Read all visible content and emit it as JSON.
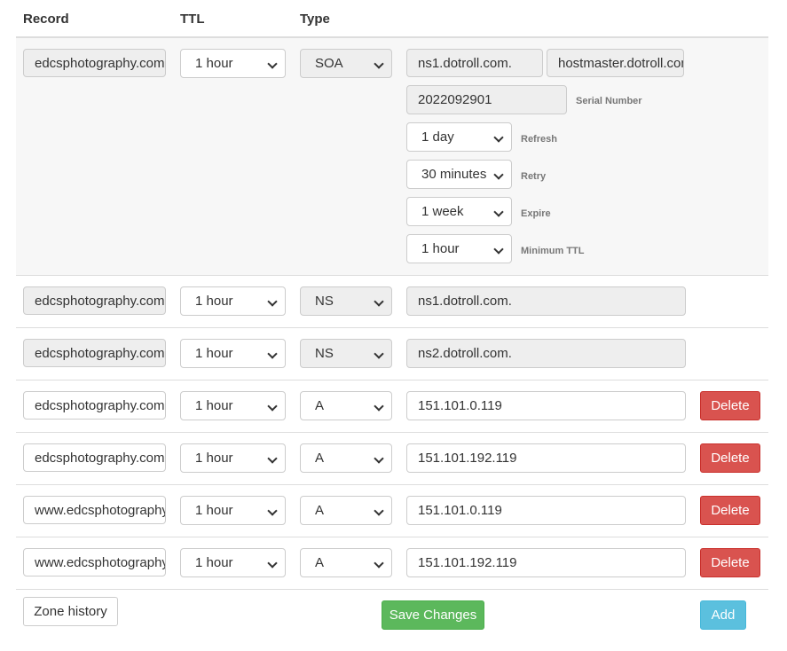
{
  "header": {
    "record": "Record",
    "ttl": "TTL",
    "type": "Type"
  },
  "soa": {
    "record": "edcsphotography.com.",
    "ttl": "1 hour",
    "type": "SOA",
    "primary_ns": "ns1.dotroll.com.",
    "hostmaster": "hostmaster.dotroll.com.",
    "serial": "2022092901",
    "serial_label": "Serial Number",
    "refresh": "1 day",
    "refresh_label": "Refresh",
    "retry": "30 minutes",
    "retry_label": "Retry",
    "expire": "1 week",
    "expire_label": "Expire",
    "min_ttl": "1 hour",
    "min_ttl_label": "Minimum TTL"
  },
  "rows": [
    {
      "record": "edcsphotography.com.",
      "ttl": "1 hour",
      "type": "NS",
      "value": "ns1.dotroll.com."
    },
    {
      "record": "edcsphotography.com.",
      "ttl": "1 hour",
      "type": "NS",
      "value": "ns2.dotroll.com."
    },
    {
      "record": "edcsphotography.com.",
      "ttl": "1 hour",
      "type": "A",
      "value": "151.101.0.119",
      "delete": "Delete"
    },
    {
      "record": "edcsphotography.com.",
      "ttl": "1 hour",
      "type": "A",
      "value": "151.101.192.119",
      "delete": "Delete"
    },
    {
      "record": "www.edcsphotography.com.",
      "ttl": "1 hour",
      "type": "A",
      "value": "151.101.0.119",
      "delete": "Delete"
    },
    {
      "record": "www.edcsphotography.com.",
      "ttl": "1 hour",
      "type": "A",
      "value": "151.101.192.119",
      "delete": "Delete"
    }
  ],
  "footer": {
    "zone_history": "Zone history",
    "save": "Save Changes",
    "add": "Add"
  },
  "colors": {
    "danger": "#d9534f",
    "success": "#5cb85c",
    "info": "#5bc0de"
  }
}
